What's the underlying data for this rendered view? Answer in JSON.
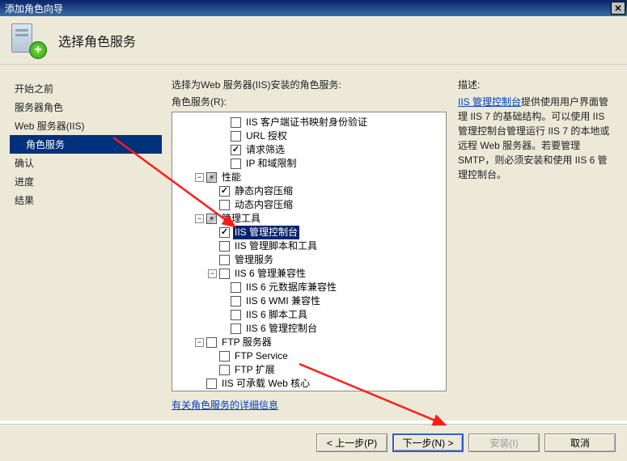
{
  "window": {
    "title": "添加角色向导",
    "close_label": "✕"
  },
  "header": {
    "title": "选择角色服务"
  },
  "sidebar": {
    "items": [
      {
        "label": "开始之前"
      },
      {
        "label": "服务器角色"
      },
      {
        "label": "Web 服务器(IIS)"
      },
      {
        "label": "角色服务",
        "indent": true,
        "selected": true
      },
      {
        "label": "确认"
      },
      {
        "label": "进度"
      },
      {
        "label": "结果"
      }
    ]
  },
  "main": {
    "instruction": "选择为Web 服务器(IIS)安装的角色服务:",
    "panel_label": "角色服务(R):",
    "more_info_link": "有关角色服务的详细信息",
    "tree": [
      {
        "depth": "i0",
        "chk": "unchecked",
        "label": "IIS 客户端证书映射身份验证"
      },
      {
        "depth": "i0",
        "chk": "unchecked",
        "label": "URL 授权"
      },
      {
        "depth": "i0",
        "chk": "checked",
        "label": "请求筛选"
      },
      {
        "depth": "i0",
        "chk": "unchecked",
        "label": "IP 和域限制"
      },
      {
        "depth": "i1",
        "toggle": "−",
        "chk": "partial",
        "label": "性能"
      },
      {
        "depth": "i2",
        "chk": "checked",
        "label": "静态内容压缩"
      },
      {
        "depth": "i2",
        "chk": "unchecked",
        "label": "动态内容压缩"
      },
      {
        "depth": "i1",
        "toggle": "−",
        "chk": "partial",
        "label": "管理工具"
      },
      {
        "depth": "i2",
        "chk": "checked",
        "label": "IIS 管理控制台",
        "selected": true
      },
      {
        "depth": "i2",
        "chk": "unchecked",
        "label": "IIS 管理脚本和工具"
      },
      {
        "depth": "i2",
        "chk": "unchecked",
        "label": "管理服务"
      },
      {
        "depth": "i2",
        "toggle": "−",
        "chk": "unchecked",
        "label": "IIS 6 管理兼容性"
      },
      {
        "depth": "i3",
        "chk": "unchecked",
        "label": "IIS 6 元数据库兼容性"
      },
      {
        "depth": "i3",
        "chk": "unchecked",
        "label": "IIS 6 WMI 兼容性"
      },
      {
        "depth": "i3",
        "chk": "unchecked",
        "label": "IIS 6 脚本工具"
      },
      {
        "depth": "i3",
        "chk": "unchecked",
        "label": "IIS 6 管理控制台"
      },
      {
        "depth": "i1",
        "toggle": "−",
        "chk": "unchecked",
        "label": "FTP 服务器"
      },
      {
        "depth": "i2",
        "chk": "unchecked",
        "label": "FTP Service"
      },
      {
        "depth": "i2",
        "chk": "unchecked",
        "label": "FTP 扩展"
      },
      {
        "depth": "i1",
        "chk": "unchecked",
        "label": "IIS 可承载 Web 核心"
      }
    ]
  },
  "description": {
    "label": "描述:",
    "link_text": "IIS 管理控制台",
    "body": "提供使用用户界面管理 IIS 7 的基础结构。可以使用 IIS 管理控制台管理运行 IIS 7 的本地或远程 Web 服务器。若要管理 SMTP，则必须安装和使用 IIS 6 管理控制台。"
  },
  "footer": {
    "back": "< 上一步(P)",
    "next": "下一步(N) >",
    "install": "安装(I)",
    "cancel": "取消"
  }
}
